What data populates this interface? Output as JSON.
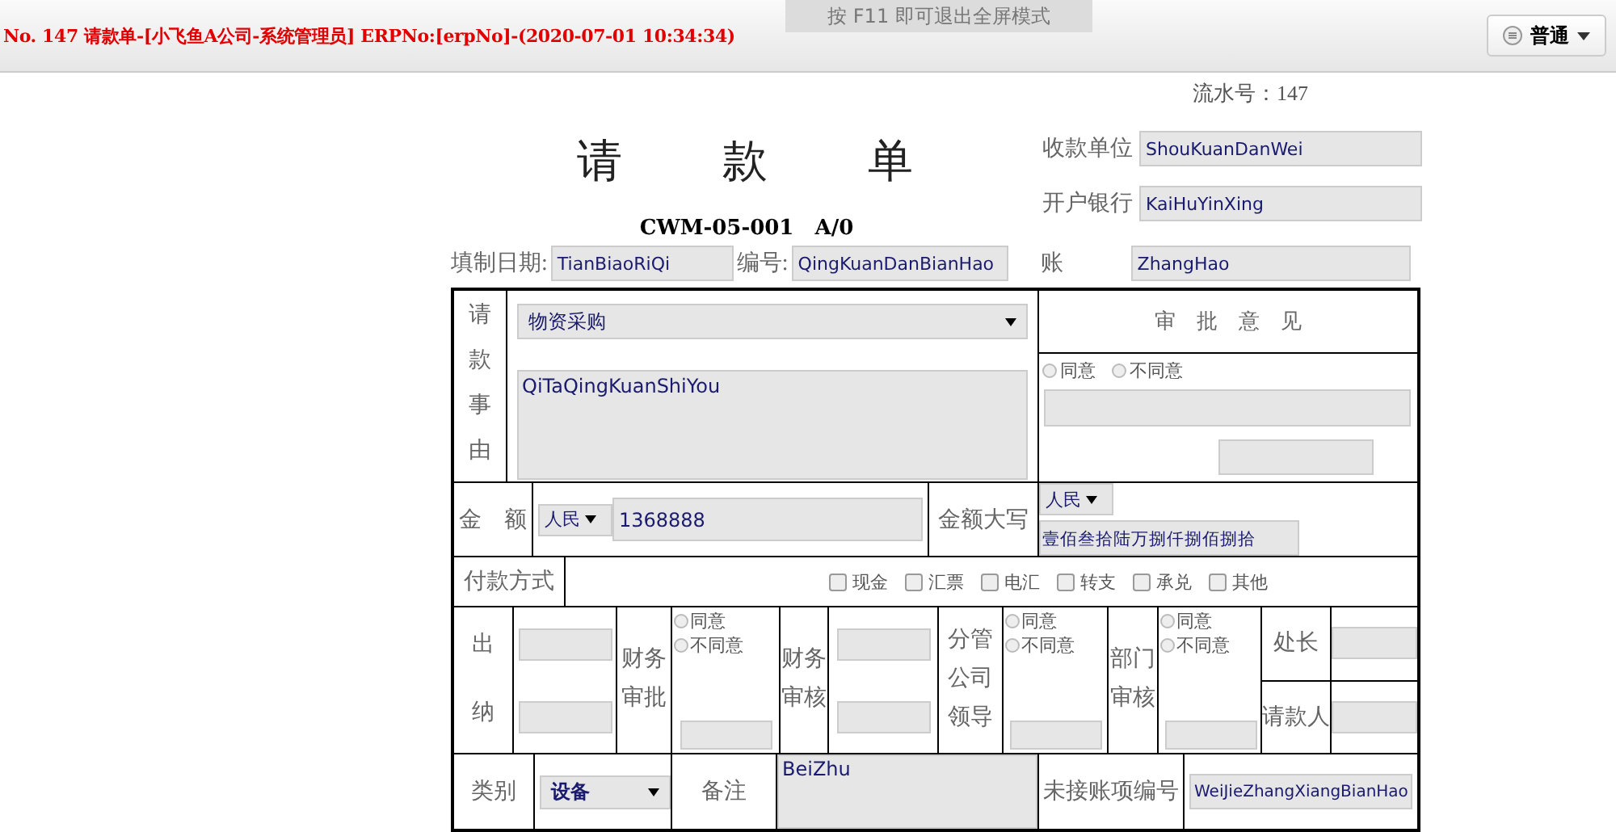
{
  "header": {
    "title": "No. 147 请款单-[小飞鱼A公司-系统管理员] ERPNo:[erpNo]-(2020-07-01 10:34:34)",
    "view_button": "普通"
  },
  "fullscreen_notice": "按 F11 即可退出全屏模式",
  "serial": {
    "label": "流水号：",
    "value": "147"
  },
  "form_title": "请　　款　　单",
  "form_code": "CWM-05-001　A/0",
  "payee": {
    "label": "收款单位",
    "value": "ShouKuanDanWei"
  },
  "bank": {
    "label": "开户银行",
    "value": "KaiHuYinXing"
  },
  "fill_date": {
    "label": "填制日期:",
    "value": "TianBiaoRiQi"
  },
  "number": {
    "label": "编号:",
    "value": "QingKuanDanBianHao"
  },
  "account": {
    "label": "账",
    "value": "ZhangHao"
  },
  "reason": {
    "label": "请款事由",
    "category": "物资采购",
    "text": "QiTaQingKuanShiYou"
  },
  "approval": {
    "heading": "审　批　意　见",
    "options": [
      {
        "label": "同意",
        "selected": false
      },
      {
        "label": "不同意",
        "selected": false
      }
    ]
  },
  "amount": {
    "label": "金　额",
    "currency": "人民",
    "value": "1368888"
  },
  "amount_words": {
    "label": "金额大写",
    "currency": "人民",
    "value": "壹佰叁拾陆万捌仟捌佰捌拾"
  },
  "payment": {
    "label": "付款方式",
    "options": [
      {
        "label": "现金",
        "checked": false
      },
      {
        "label": "汇票",
        "checked": false
      },
      {
        "label": "电汇",
        "checked": false
      },
      {
        "label": "转支",
        "checked": false
      },
      {
        "label": "承兑",
        "checked": false
      },
      {
        "label": "其他",
        "checked": false
      }
    ]
  },
  "cashier": {
    "label": "出纳"
  },
  "signoffs": [
    {
      "label": "财务审批",
      "options": [
        {
          "label": "同意",
          "selected": false
        },
        {
          "label": "不同意",
          "selected": false
        }
      ]
    },
    {
      "label": "分管公司领导",
      "options": [
        {
          "label": "同意",
          "selected": false
        },
        {
          "label": "不同意",
          "selected": false
        }
      ]
    },
    {
      "label": "部门审核",
      "options": [
        {
          "label": "同意",
          "selected": false
        },
        {
          "label": "不同意",
          "selected": false
        }
      ]
    }
  ],
  "finance_review": {
    "label": "财务审核"
  },
  "director": {
    "label": "处长"
  },
  "requester": {
    "label": "请款人"
  },
  "category": {
    "label": "类别",
    "value": "设备"
  },
  "remark": {
    "label": "备注",
    "value": "BeiZhu"
  },
  "unposted": {
    "label": "未接账项编号",
    "value": "WeiJieZhangXiangBianHao"
  }
}
